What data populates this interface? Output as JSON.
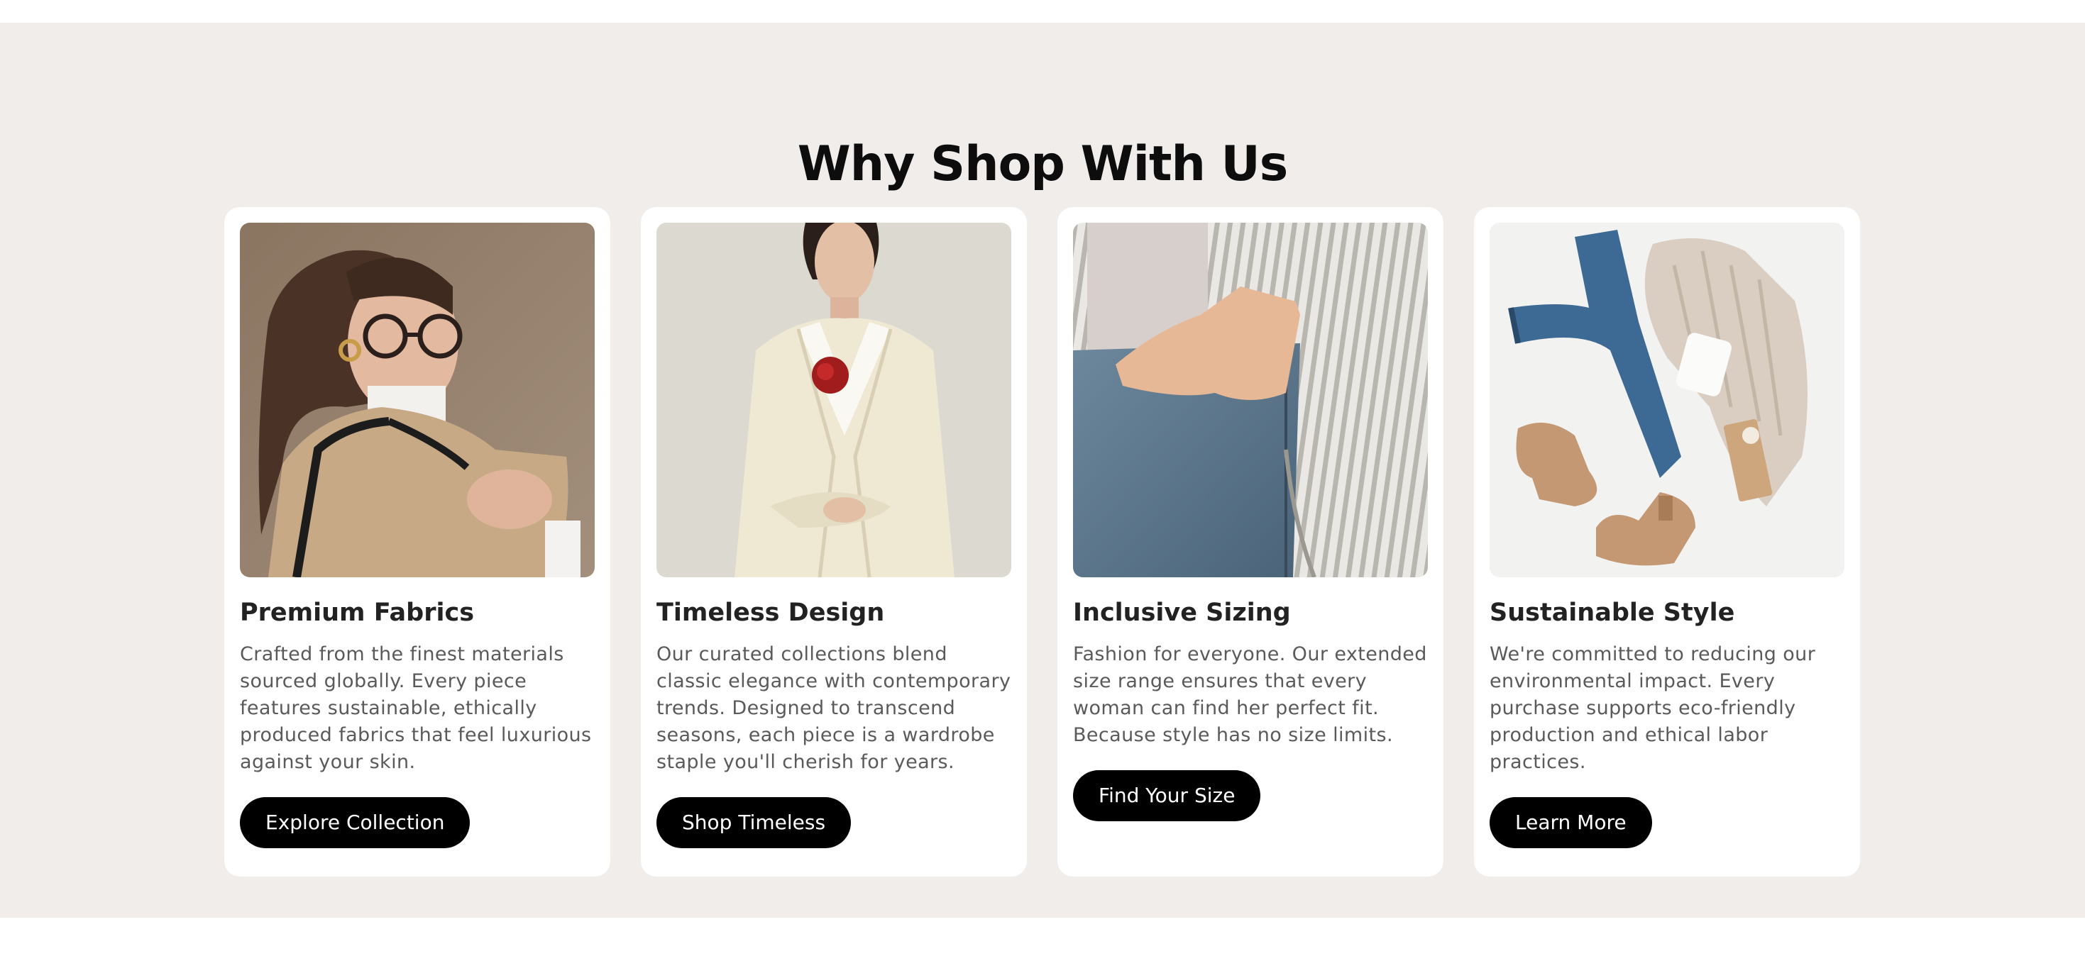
{
  "section": {
    "title": "Why Shop With Us",
    "background_color": "#f0edeb"
  },
  "cards": [
    {
      "title": "Premium Fabrics",
      "text": "Crafted from the finest materials sourced globally. Every piece features sustainable, ethically produced fabrics that feel luxurious against your skin.",
      "button_label": "Explore Collection",
      "image_subject": "woman-with-glasses-camel-cape-photo"
    },
    {
      "title": "Timeless Design",
      "text": "Our curated collections blend classic elegance with contemporary trends. Designed to transcend seasons, each piece is a wardrobe staple you'll cherish for years.",
      "button_label": "Shop Timeless",
      "image_subject": "woman-cream-blazer-red-rose-photo"
    },
    {
      "title": "Inclusive Sizing",
      "text": "Fashion for everyone. Our extended size range ensures that every woman can find her perfect fit. Because style has no size limits.",
      "button_label": "Find Your Size",
      "image_subject": "hand-in-jeans-pocket-striped-shirt-photo"
    },
    {
      "title": "Sustainable Style",
      "text": "We're committed to reducing our environmental impact. Every purchase supports eco-friendly production and ethical labor practices.",
      "button_label": "Learn More",
      "image_subject": "flat-lay-jeans-sweater-boots-mug-photo"
    }
  ],
  "colors": {
    "button_background": "#000000",
    "button_text": "#ffffff",
    "card_background": "#ffffff",
    "title_text": "#222222",
    "body_text": "#5a5a5a"
  }
}
